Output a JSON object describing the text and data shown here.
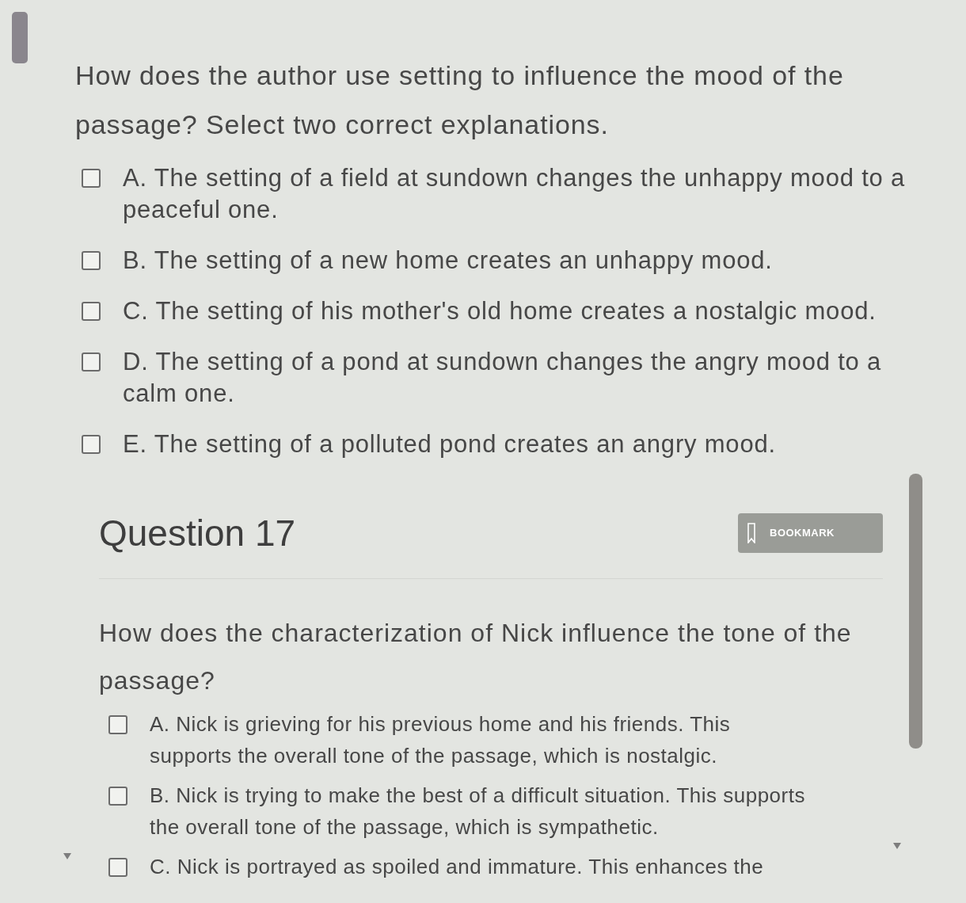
{
  "question_16": {
    "prompt": "How does the author use setting to influence the mood of the passage? Select two correct explanations.",
    "options": [
      {
        "text": "A. The setting of a field at sundown changes the unhappy mood to a peaceful one.",
        "checked": false
      },
      {
        "text": "B. The setting of a new home creates an unhappy mood.",
        "checked": false
      },
      {
        "text": "C. The setting of his mother's old home creates a nostalgic mood.",
        "checked": false
      },
      {
        "text": "D. The setting of a pond at sundown changes the angry mood to a calm one.",
        "checked": false
      },
      {
        "text": "E. The setting of a polluted pond creates an angry mood.",
        "checked": false
      }
    ]
  },
  "question_17": {
    "title": "Question 17",
    "bookmark": {
      "label": "BOOKMARK"
    },
    "prompt": "How does the characterization of Nick influence the tone of the passage?",
    "options": [
      {
        "text": "A. Nick is grieving for his previous home and his friends. This supports the overall tone of the passage, which is nostalgic.",
        "checked": false
      },
      {
        "text": "B. Nick is trying to make the best of a difficult situation. This supports the overall tone of the passage, which is sympathetic.",
        "checked": false
      },
      {
        "text": "C. Nick is portrayed as spoiled and immature. This enhances the",
        "checked": false
      }
    ]
  }
}
